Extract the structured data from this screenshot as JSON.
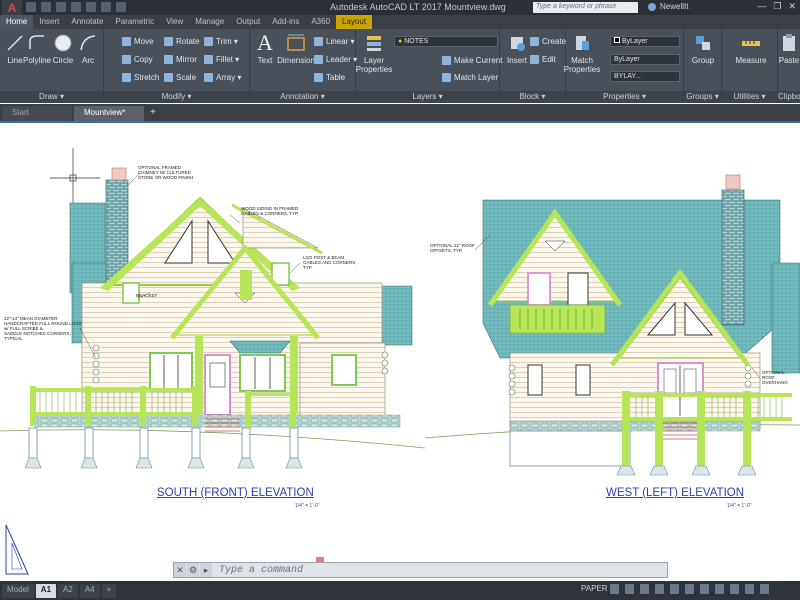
{
  "titlebar": {
    "app_logo": "A",
    "title": "Autodesk AutoCAD LT 2017   Mountview.dwg",
    "search_placeholder": "Type a keyword or phrase",
    "user": "NewellIt",
    "minimize": "—",
    "restore": "❐",
    "close": "✕"
  },
  "ribbon_tabs": [
    "Home",
    "Insert",
    "Annotate",
    "Parametric",
    "View",
    "Manage",
    "Output",
    "Add-ins",
    "A360",
    "Layout"
  ],
  "ribbon": {
    "draw": {
      "title": "Draw ▾",
      "line": "Line",
      "polyline": "Polyline",
      "circle": "Circle",
      "arc": "Arc"
    },
    "modify": {
      "title": "Modify ▾",
      "move": "Move",
      "rotate": "Rotate",
      "trim": "Trim ▾",
      "copy": "Copy",
      "mirror": "Mirror",
      "fillet": "Fillet ▾",
      "stretch": "Stretch",
      "scale": "Scale",
      "array": "Array ▾"
    },
    "annotation": {
      "title": "Annotation ▾",
      "text": "Text",
      "dimension": "Dimension",
      "linear": "Linear ▾",
      "leader": "Leader ▾",
      "table": "Table"
    },
    "layers": {
      "title": "Layers ▾",
      "layer_properties": "Layer Properties",
      "current_layer": "NOTES",
      "make_current": "Make Current",
      "match_layer": "Match Layer"
    },
    "block": {
      "title": "Block ▾",
      "insert": "Insert",
      "create": "Create",
      "edit": "Edit"
    },
    "properties": {
      "title": "Properties ▾",
      "match_properties": "Match Properties",
      "color": "ByLayer",
      "linetype": "ByLayer",
      "lineweight": "BYLAY..."
    },
    "groups": {
      "title": "Groups ▾",
      "group": "Group"
    },
    "utilities": {
      "title": "Utilities ▾",
      "measure": "Measure"
    },
    "clipboard": {
      "title": "Clipbo",
      "paste": "Paste"
    }
  },
  "doc_tabs": [
    "Start",
    "Mountview*"
  ],
  "drawing": {
    "south_title": "SOUTH (FRONT) ELEVATION",
    "south_scale": "1/4\" = 1'-0\"",
    "west_title": "WEST (LEFT) ELEVATION",
    "west_scale": "1/4\" = 1'-0\"",
    "note_chimney": "OPTIONAL FRAMED\nCHIMNEY W/ CULTURED\nSTONE OR WOOD FINISH",
    "note_siding": "WOOD SIDING IN FRAMED\nGABLES & CORNERS, TYP.",
    "note_logpost": "LOG POST & BEAM\nGABLES AND CORNERS,\nTYP.",
    "note_logs": "12\"-14\" MEAN DIAMETER\nHANDCRAFTED FULL ROUND LOGS\nw/ FULL SCRIBE &\nSADDLE-NOTCHED CORNERS,\nTYPICAL",
    "note_roof": "OPTIONAL 12\" ROOF\nOFFSETS, TYP.",
    "note_right": "OPTIONAL\nROOF\nOVERHANG",
    "note_bracket": "BRACKET"
  },
  "command_line": {
    "close": "✕",
    "tools": "🔧",
    "prompt": "Type a command"
  },
  "layout_tabs": [
    "Model",
    "A1",
    "A2",
    "A4",
    "+"
  ],
  "status": {
    "space": "PAPER"
  }
}
